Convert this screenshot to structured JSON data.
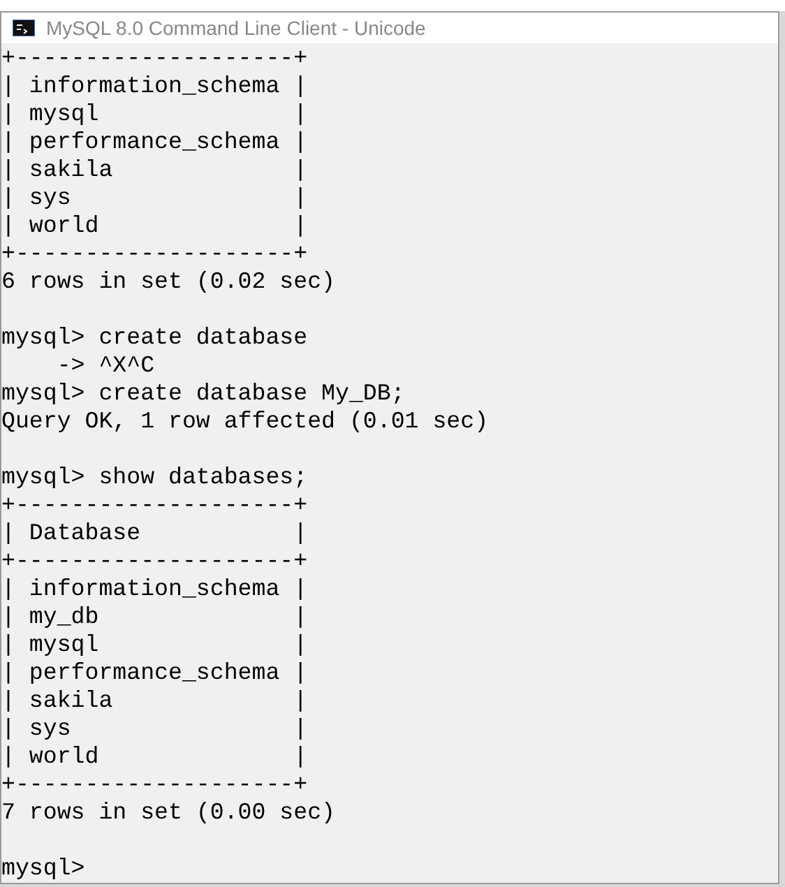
{
  "window": {
    "title": "MySQL 8.0 Command Line Client - Unicode"
  },
  "console": {
    "blocks": [
      [
        "+--------------------+",
        "| information_schema |",
        "| mysql              |",
        "| performance_schema |",
        "| sakila             |",
        "| sys                |",
        "| world              |",
        "+--------------------+",
        "6 rows in set (0.02 sec)"
      ],
      [
        "mysql> create database",
        "    -> ^X^C",
        "mysql> create database My_DB;",
        "Query OK, 1 row affected (0.01 sec)"
      ],
      [
        "mysql> show databases;",
        "+--------------------+",
        "| Database           |",
        "+--------------------+",
        "| information_schema |",
        "| my_db              |",
        "| mysql              |",
        "| performance_schema |",
        "| sakila             |",
        "| sys                |",
        "| world              |",
        "+--------------------+",
        "7 rows in set (0.00 sec)"
      ],
      [
        "mysql>"
      ]
    ]
  }
}
